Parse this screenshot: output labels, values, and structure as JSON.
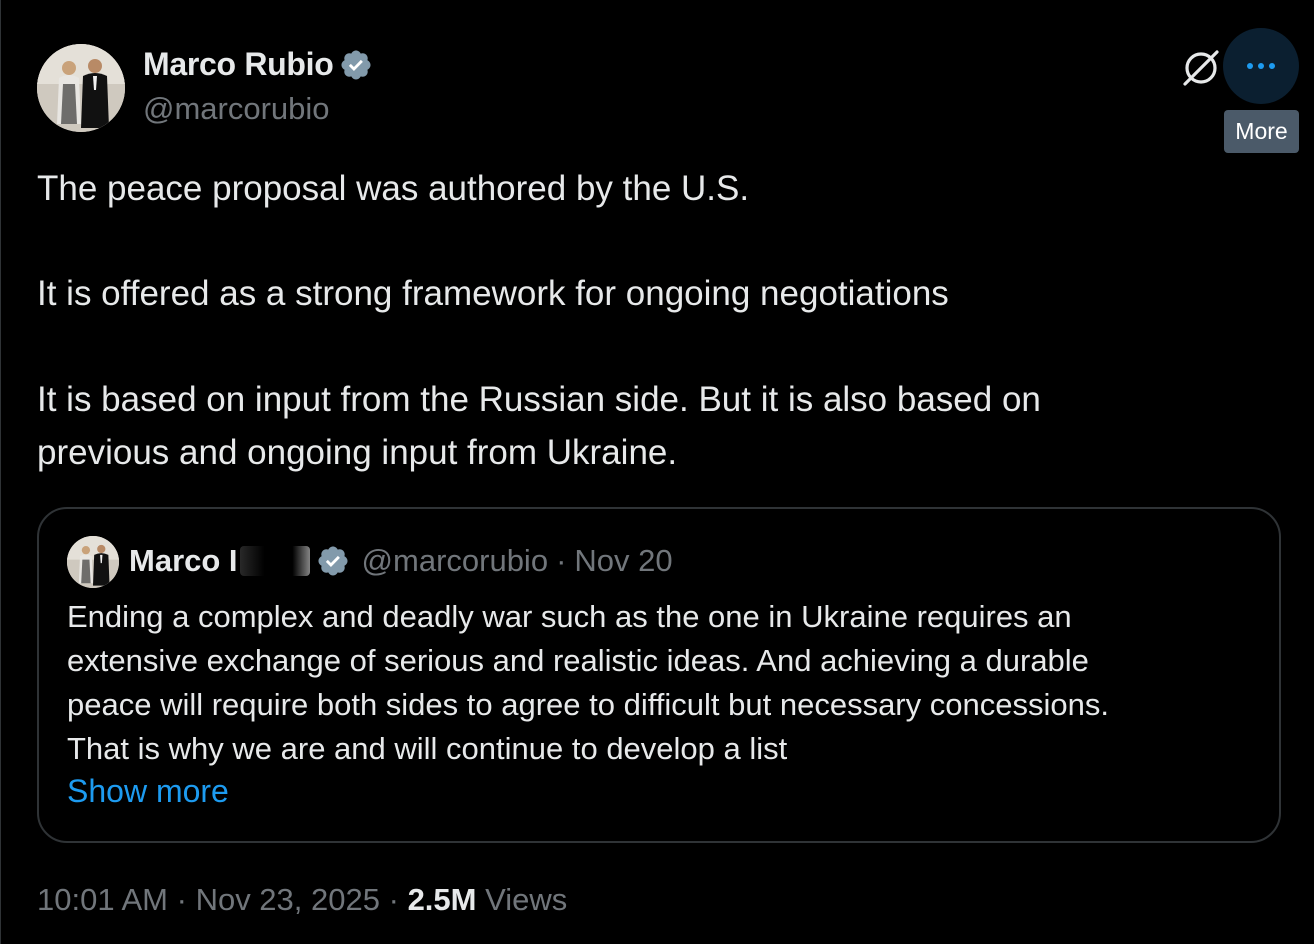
{
  "author": {
    "name": "Marco Rubio",
    "handle": "@marcorubio",
    "verified": true
  },
  "actions": {
    "tooltip": "More"
  },
  "body": {
    "paragraph_1": "The peace proposal was authored by the U.S.",
    "paragraph_2": "It is offered as a strong framework for ongoing negotiations",
    "paragraph_3_line_1": "It is based on input from the Russian side. But it is also based on",
    "paragraph_3_line_2": "previous and ongoing input from Ukraine."
  },
  "quote": {
    "name": "Marco I",
    "handle": "@marcorubio",
    "separator": "·",
    "date": "Nov 20",
    "text_lines": [
      "Ending a complex and deadly war such as the one in Ukraine requires an",
      "extensive exchange of serious and realistic ideas. And achieving a durable",
      "peace will require both sides to agree to difficult but necessary concessions.",
      "That is why we are and will continue to develop a list"
    ],
    "show_more": "Show more"
  },
  "meta": {
    "time": "10:01 AM",
    "separator": "·",
    "date": "Nov 23, 2025",
    "views_count": "2.5M",
    "views_label": "Views"
  },
  "colors": {
    "background": "#000000",
    "text_primary": "#e7e9ea",
    "text_secondary": "#71767b",
    "accent": "#1d9bf0",
    "border": "#2f3336",
    "verified_badge": "#829aab"
  }
}
